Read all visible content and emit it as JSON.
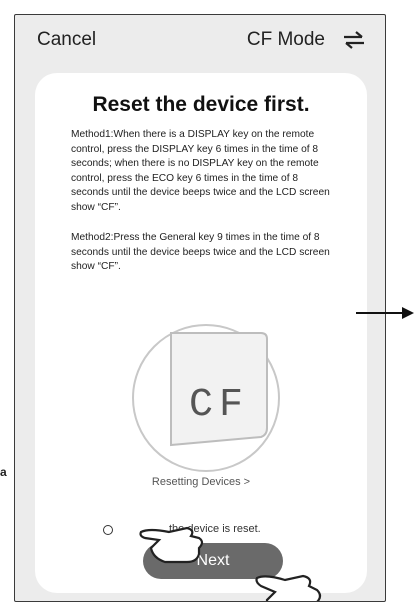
{
  "topbar": {
    "cancel_label": "Cancel",
    "mode_label": "CF Mode",
    "switch_icon": "switch-arrows-icon"
  },
  "card": {
    "title": "Reset the device first.",
    "method1": "Method1:When there is a DISPLAY key on the remote control, press the DISPLAY key 6 times in the time of 8 seconds; when there is no DISPLAY key on the remote control, press the ECO key 6 times in the time of 8 seconds until the device beeps twice and the LCD screen show “CF”.",
    "method2": "Method2:Press the General key 9 times in the time of 8 seconds until the device beeps twice and the LCD screen show “CF”.",
    "display_text": "CF",
    "resetting_link": "Resetting Devices >",
    "confirm_text": "the device is reset.",
    "next_label": "Next"
  },
  "side_fragment": "a"
}
